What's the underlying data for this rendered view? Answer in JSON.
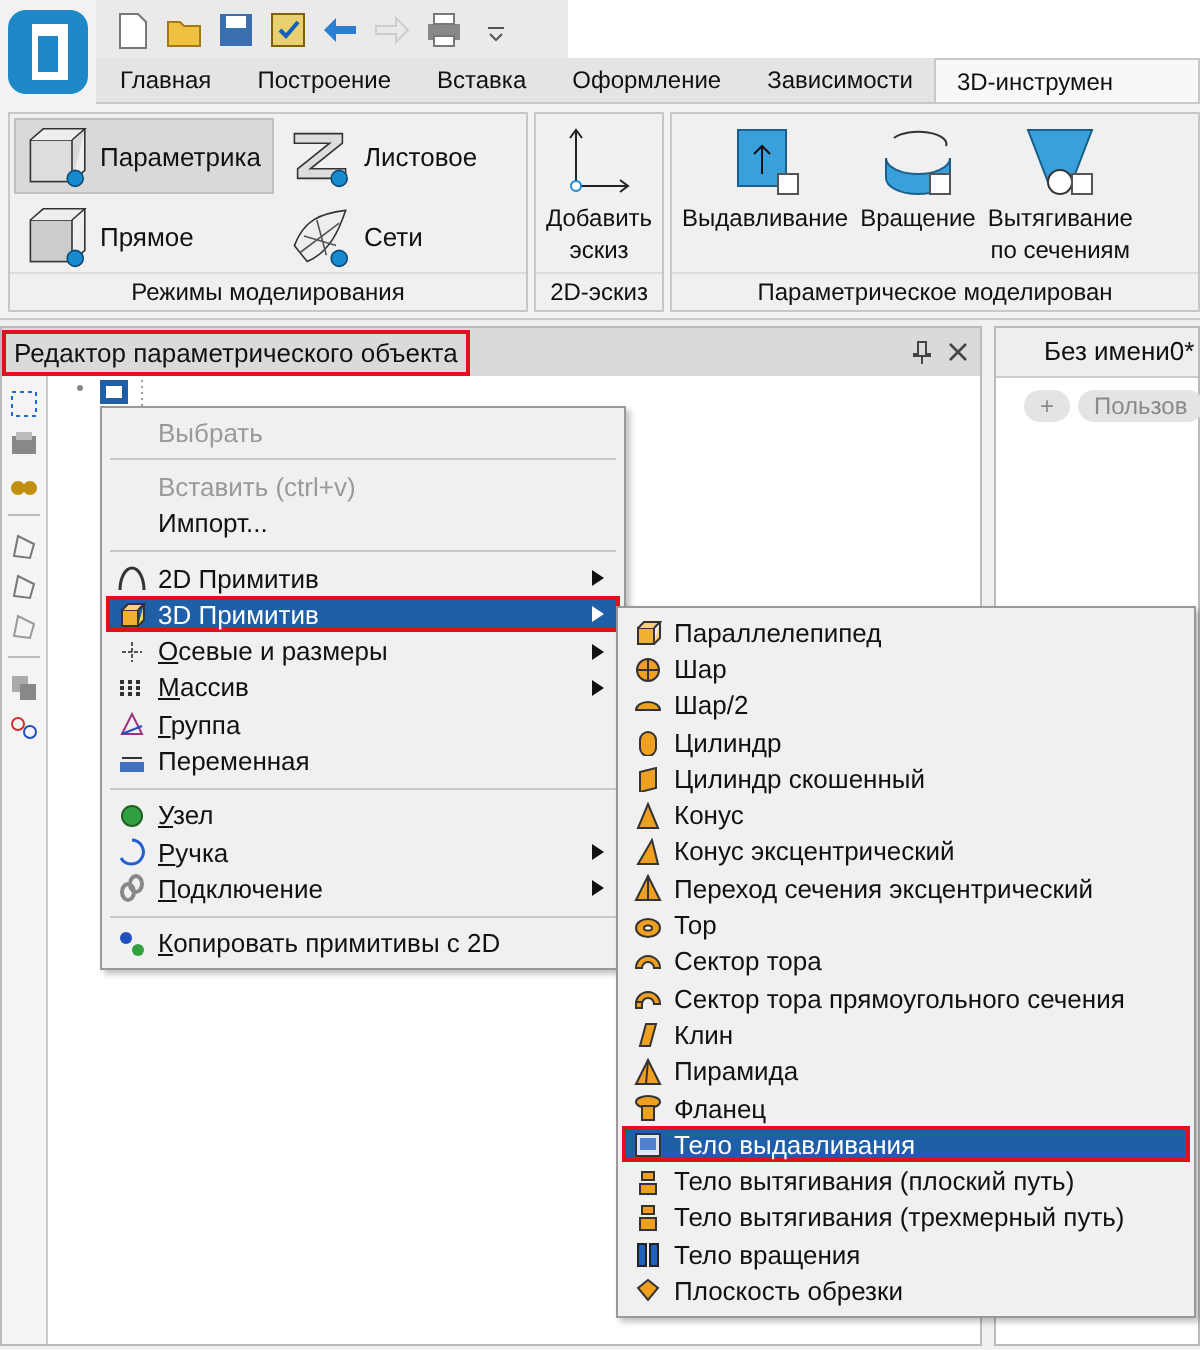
{
  "ribbon": {
    "tabs": [
      {
        "label": "Главная",
        "selected": false
      },
      {
        "label": "Построение",
        "selected": false
      },
      {
        "label": "Вставка",
        "selected": false
      },
      {
        "label": "Оформление",
        "selected": false
      },
      {
        "label": "Зависимости",
        "selected": false
      },
      {
        "label": "3D-инструмен",
        "selected": true
      }
    ],
    "groups": [
      {
        "kind": "modes",
        "title": "Режимы моделирования",
        "buttons": [
          {
            "label": "Параметрика",
            "selected": true
          },
          {
            "label": "Листовое",
            "selected": false
          },
          {
            "label": "Прямое",
            "selected": false
          },
          {
            "label": "Сети",
            "selected": false
          }
        ]
      },
      {
        "kind": "large",
        "title": "2D-эскиз",
        "buttons": [
          {
            "label": "Добавить\nэскиз"
          }
        ]
      },
      {
        "kind": "large",
        "title": "Параметрическое моделирован",
        "buttons": [
          {
            "label": "Выдавливание"
          },
          {
            "label": "Вращение"
          },
          {
            "label": "Вытягивание\nпо сечениям"
          }
        ]
      }
    ]
  },
  "editor_pane": {
    "title": "Редактор параметрического объекта",
    "highlighted": true
  },
  "document_pane": {
    "tab": "Без имени0*",
    "chips": [
      "+",
      "Пользов"
    ]
  },
  "context_menu": {
    "items": [
      {
        "kind": "item",
        "label": "Выбрать",
        "disabled": true,
        "submenu": false,
        "selected": false,
        "highlighted": false,
        "underlined": false
      },
      {
        "kind": "separator"
      },
      {
        "kind": "item",
        "label": "Вставить (ctrl+v)",
        "disabled": true,
        "submenu": false,
        "selected": false,
        "highlighted": false,
        "underlined": false
      },
      {
        "kind": "item",
        "label": "Импорт...",
        "disabled": false,
        "submenu": false,
        "selected": false,
        "highlighted": false,
        "underlined": false
      },
      {
        "kind": "separator"
      },
      {
        "kind": "item",
        "label": "2D Примитив",
        "disabled": false,
        "submenu": true,
        "selected": false,
        "highlighted": false,
        "underlined": false
      },
      {
        "kind": "item",
        "label": "3D Примитив",
        "disabled": false,
        "submenu": true,
        "selected": true,
        "highlighted": true,
        "underlined": false
      },
      {
        "kind": "item",
        "label": "Осевые и размеры",
        "disabled": false,
        "submenu": true,
        "selected": false,
        "highlighted": false,
        "underlined": true
      },
      {
        "kind": "item",
        "label": "Массив",
        "disabled": false,
        "submenu": true,
        "selected": false,
        "highlighted": false,
        "underlined": true
      },
      {
        "kind": "item",
        "label": "Группа",
        "disabled": false,
        "submenu": false,
        "selected": false,
        "highlighted": false,
        "underlined": true
      },
      {
        "kind": "item",
        "label": "Переменная",
        "disabled": false,
        "submenu": false,
        "selected": false,
        "highlighted": false,
        "underlined": false
      },
      {
        "kind": "separator"
      },
      {
        "kind": "item",
        "label": "Узел",
        "disabled": false,
        "submenu": false,
        "selected": false,
        "highlighted": false,
        "underlined": true
      },
      {
        "kind": "item",
        "label": "Ручка",
        "disabled": false,
        "submenu": true,
        "selected": false,
        "highlighted": false,
        "underlined": true
      },
      {
        "kind": "item",
        "label": "Подключение",
        "disabled": false,
        "submenu": true,
        "selected": false,
        "highlighted": false,
        "underlined": true
      },
      {
        "kind": "separator"
      },
      {
        "kind": "item",
        "label": "Копировать примитивы с 2D",
        "disabled": false,
        "submenu": false,
        "selected": false,
        "highlighted": false,
        "underlined": true
      }
    ]
  },
  "submenu": {
    "items": [
      {
        "label": "Параллелепипед",
        "selected": false,
        "highlighted": false
      },
      {
        "label": "Шар",
        "selected": false,
        "highlighted": false
      },
      {
        "label": "Шар/2",
        "selected": false,
        "highlighted": false
      },
      {
        "label": "Цилиндр",
        "selected": false,
        "highlighted": false
      },
      {
        "label": "Цилиндр скошенный",
        "selected": false,
        "highlighted": false
      },
      {
        "label": "Конус",
        "selected": false,
        "highlighted": false
      },
      {
        "label": "Конус эксцентрический",
        "selected": false,
        "highlighted": false
      },
      {
        "label": "Переход сечения эксцентрический",
        "selected": false,
        "highlighted": false
      },
      {
        "label": "Тор",
        "selected": false,
        "highlighted": false
      },
      {
        "label": "Сектор тора",
        "selected": false,
        "highlighted": false
      },
      {
        "label": "Сектор тора прямоугольного сечения",
        "selected": false,
        "highlighted": false
      },
      {
        "label": "Клин",
        "selected": false,
        "highlighted": false
      },
      {
        "label": "Пирамида",
        "selected": false,
        "highlighted": false
      },
      {
        "label": "Фланец",
        "selected": false,
        "highlighted": false
      },
      {
        "label": "Тело выдавливания",
        "selected": true,
        "highlighted": true
      },
      {
        "label": "Тело вытягивания (плоский путь)",
        "selected": false,
        "highlighted": false
      },
      {
        "label": "Тело вытягивания (трехмерный путь)",
        "selected": false,
        "highlighted": false
      },
      {
        "label": "Тело вращения",
        "selected": false,
        "highlighted": false
      },
      {
        "label": "Плоскость обрезки",
        "selected": false,
        "highlighted": false
      }
    ]
  }
}
